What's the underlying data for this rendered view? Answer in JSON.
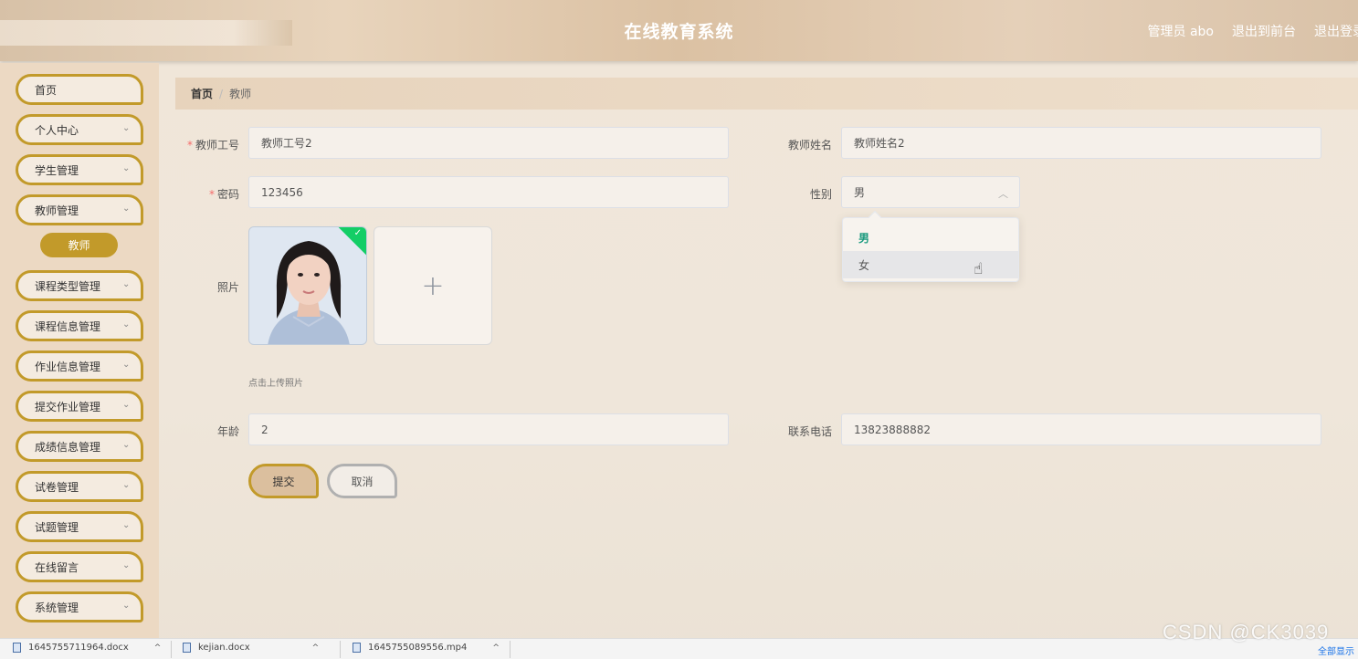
{
  "header": {
    "title": "在线教育系统",
    "user": "管理员 abo",
    "back_frontend": "退出到前台",
    "logout": "退出登录"
  },
  "sidebar": {
    "items": [
      {
        "label": "首页",
        "has_chevron": false
      },
      {
        "label": "个人中心",
        "has_chevron": true
      },
      {
        "label": "学生管理",
        "has_chevron": true
      },
      {
        "label": "教师管理",
        "has_chevron": true
      },
      {
        "label": "课程类型管理",
        "has_chevron": true
      },
      {
        "label": "课程信息管理",
        "has_chevron": true
      },
      {
        "label": "作业信息管理",
        "has_chevron": true
      },
      {
        "label": "提交作业管理",
        "has_chevron": true
      },
      {
        "label": "成绩信息管理",
        "has_chevron": true
      },
      {
        "label": "试卷管理",
        "has_chevron": true
      },
      {
        "label": "试题管理",
        "has_chevron": true
      },
      {
        "label": "在线留言",
        "has_chevron": true
      },
      {
        "label": "系统管理",
        "has_chevron": true
      }
    ],
    "active_sub": "教师"
  },
  "breadcrumb": {
    "home": "首页",
    "current": "教师"
  },
  "form": {
    "teacher_id": {
      "label": "教师工号",
      "value": "教师工号2",
      "required": true
    },
    "teacher_name": {
      "label": "教师姓名",
      "value": "教师姓名2"
    },
    "password": {
      "label": "密码",
      "value": "123456",
      "required": true
    },
    "gender": {
      "label": "性别",
      "value": "男",
      "options": [
        "男",
        "女"
      ],
      "selected": "男",
      "hovered": "女"
    },
    "photo": {
      "label": "照片",
      "tip": "点击上传照片",
      "add_symbol": "+"
    },
    "age": {
      "label": "年龄",
      "value": "2"
    },
    "phone": {
      "label": "联系电话",
      "value": "13823888882"
    },
    "submit": "提交",
    "cancel": "取消"
  },
  "downloads": [
    {
      "name": "1645755711964.docx"
    },
    {
      "name": "kejian.docx"
    },
    {
      "name": "1645755089556.mp4"
    }
  ],
  "show_all": "全部显示",
  "watermark": "CSDN @CK3039",
  "colors": {
    "accent": "#c29a2a",
    "selected_option": "#1a9a7e",
    "required": "#f56c6c"
  }
}
